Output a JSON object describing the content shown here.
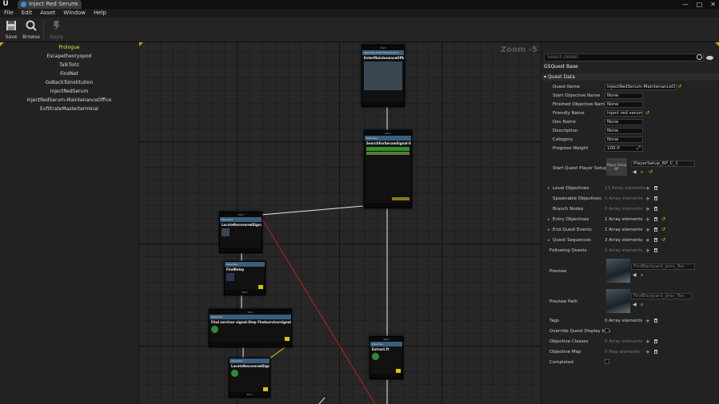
{
  "window": {
    "tab_title": "Inject Red Serum",
    "close_tab": "x",
    "min_btn": "—",
    "max_btn": "□",
    "close_btn": "✕"
  },
  "menu": [
    "File",
    "Edit",
    "Asset",
    "Window",
    "Help"
  ],
  "toolbar": {
    "save": "Save",
    "browse": "Browse",
    "apply": "Apply"
  },
  "quest_list": [
    "Prologue",
    "Escapetheoryopod",
    "TalkTo0z",
    "FindNet",
    "GoBackToInstitution",
    "InjectRedSerum",
    "InjectRedSerum-MaintenanceOffice",
    "ExfiltrateMasterterminal"
  ],
  "graph": {
    "zoom": "Zoom -5",
    "nodes": {
      "n1": {
        "title": "EnterMaintenanceOffice",
        "header": "Objective Enter Maintenance",
        "pin": "Start"
      },
      "n2": {
        "title": "SearchForSerumSignal-Step 2",
        "header": "Objective",
        "pin": "Start"
      },
      "n3": {
        "title": "LocateRecoveredSignal",
        "header": "Objective",
        "pin": "Start"
      },
      "n4": {
        "title": "FindRelay",
        "header": "Objective",
        "pin": "Start"
      },
      "n5": {
        "title": "Find survivor signal-Step Findsurvivorsignal-Copy-Copy",
        "header": "Objective",
        "pin": "Start"
      },
      "n6": {
        "title": "LocateRecoveredSignal",
        "header": "Objective",
        "pin": "Start"
      },
      "n7": {
        "title": "Extract.ft",
        "header": "Objective",
        "pin": "Start"
      }
    }
  },
  "details": {
    "search_placeholder": "Search Details",
    "class_name": "GSQuest Base",
    "section": "Quest Data",
    "props": {
      "quest_name": {
        "label": "Quest Name",
        "value": "InjectRedSerum-MaintenanceOffice"
      },
      "start_objective_name": {
        "label": "Start Objective Name",
        "value": "None"
      },
      "finished_objective_name": {
        "label": "Finished Objective Name",
        "value": "None"
      },
      "friendly_name": {
        "label": "Friendly Name",
        "value": "inject red serum"
      },
      "dev_name": {
        "label": "Dev Name",
        "value": "None"
      },
      "description": {
        "label": "Description",
        "value": "None"
      },
      "category": {
        "label": "Category",
        "value": "None"
      },
      "progress_weight": {
        "label": "Progress Weight",
        "value": "100.0"
      },
      "start_quest_player_setup": {
        "label": "Start Quest Player Setup",
        "thumb": "Player Setup BP",
        "value": "PlayerSetup_BP_C_1"
      },
      "level_objectives": {
        "label": "Level Objectives",
        "value": "13 Array elements"
      },
      "spawnable_objectives": {
        "label": "Spawnable Objectives",
        "value": "0 Array elements"
      },
      "branch_nodes": {
        "label": "Branch Nodes",
        "value": "0 Array elements"
      },
      "entry_objectives": {
        "label": "Entry Objectives",
        "value": "1 Array elements"
      },
      "end_quest_events": {
        "label": "End Quest Events",
        "value": "1 Array elements"
      },
      "quest_sequences": {
        "label": "Quest Sequences",
        "value": "3 Array elements"
      },
      "following_quests": {
        "label": "Following Quests",
        "value": "0 Array elements"
      },
      "preview": {
        "label": "Preview",
        "value": "FindBackyard_prev_Tex"
      },
      "preview_path": {
        "label": "Preview Path",
        "value": "FindBackyard_prev_Tex"
      },
      "tags": {
        "label": "Tags",
        "value": "0 Array elements"
      },
      "override_display": {
        "label": "Override Quest Display Info"
      },
      "objective_classes": {
        "label": "Objective Classes",
        "value": "0 Array elements"
      },
      "objective_map": {
        "label": "Objective Map",
        "value": "0 Map elements"
      },
      "completed": {
        "label": "Completed"
      }
    }
  },
  "colors": {
    "accent": "#d2a100",
    "selection_text": "#e5e34a",
    "wire_white": "#e8e8e8",
    "wire_yellow": "#e8d000",
    "wire_red": "#c0201a"
  }
}
